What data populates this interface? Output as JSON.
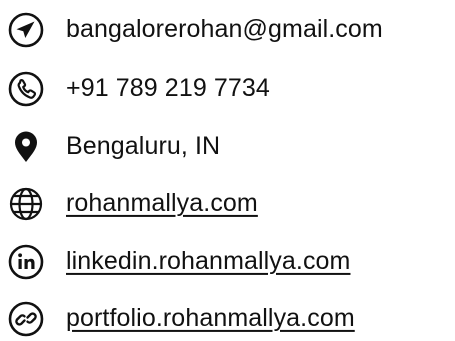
{
  "contacts": [
    {
      "icon": "telegram-send-icon",
      "text": "bangalorerohan@gmail.com",
      "link": false
    },
    {
      "icon": "phone-icon",
      "text": "+91 789 219 7734",
      "link": false
    },
    {
      "icon": "location-pin-icon",
      "text": "Bengaluru, IN",
      "link": false
    },
    {
      "icon": "globe-icon",
      "text": "rohanmallya.com",
      "link": true
    },
    {
      "icon": "linkedin-icon",
      "text": "linkedin.rohanmallya.com",
      "link": true
    },
    {
      "icon": "link-icon",
      "text": "portfolio.rohanmallya.com",
      "link": true
    }
  ],
  "colors": {
    "text": "#111111",
    "background": "#ffffff"
  }
}
